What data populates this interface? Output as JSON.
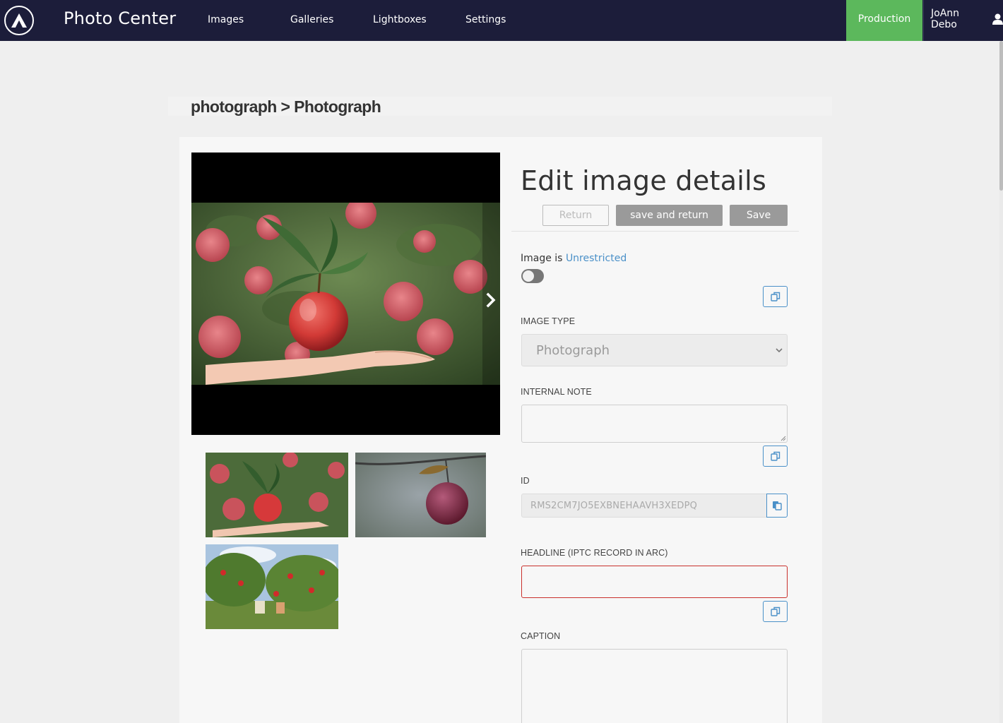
{
  "nav": {
    "app_title": "Photo Center",
    "items": [
      {
        "label": "Images"
      },
      {
        "label": "Galleries"
      },
      {
        "label": "Lightboxes"
      },
      {
        "label": "Settings"
      }
    ],
    "environment": "Production",
    "user_name": "JoAnn Debo",
    "brand_color": "#1c1d3a",
    "env_color": "#5cb85c"
  },
  "breadcrumb": {
    "text": "photograph > Photograph"
  },
  "viewer": {
    "next_icon": "chevron-right-icon",
    "thumbnails": [
      {
        "subject": "apple on hand"
      },
      {
        "subject": "red apple on branch"
      },
      {
        "subject": "apple orchard"
      }
    ]
  },
  "form": {
    "title": "Edit image details",
    "buttons": {
      "return": "Return",
      "save_and_return": "save and return",
      "save": "Save"
    },
    "restriction": {
      "prefix": "Image is",
      "status": "Unrestricted",
      "toggle_on": false
    },
    "image_type": {
      "label": "IMAGE TYPE",
      "value": "Photograph"
    },
    "internal_note": {
      "label": "INTERNAL NOTE",
      "value": ""
    },
    "id": {
      "label": "ID",
      "value": "RMS2CM7JO5EXBNEHAAVH3XEDPQ"
    },
    "headline": {
      "label": "HEADLINE (IPTC RECORD IN ARC)",
      "value": "",
      "error_color": "#c9302c"
    },
    "caption": {
      "label": "CAPTION",
      "value": ""
    },
    "accent_color": "#4a90c8"
  }
}
